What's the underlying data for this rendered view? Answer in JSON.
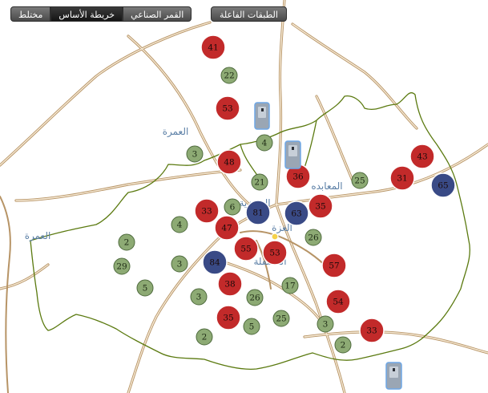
{
  "toolbar": {
    "mixed_label": "مختلط",
    "basemap_label": "خريطة الأساس",
    "satellite_label": "القمر الصناعي",
    "layers_label": "الطبقات الفاعلة",
    "active_tab": "basemap"
  },
  "colors": {
    "red": "#c22a2a",
    "blue": "#394a86",
    "green": "#8daa74",
    "road": "#c8a77a",
    "boundary": "#5b7a10"
  },
  "places": [
    {
      "id": "umra-north",
      "text": "العمرة"
    },
    {
      "id": "umra-west",
      "text": "العمرة"
    },
    {
      "id": "maabda",
      "text": "المعابده"
    },
    {
      "id": "aziziya",
      "text": "العزيزية"
    },
    {
      "id": "ghazza",
      "text": "الغزة"
    },
    {
      "id": "masfala",
      "text": "المسفلة"
    }
  ],
  "markers": [
    {
      "id": "m41",
      "value": "41",
      "color": "red"
    },
    {
      "id": "m22",
      "value": "22",
      "color": "green"
    },
    {
      "id": "m53a",
      "value": "53",
      "color": "red"
    },
    {
      "id": "m4a",
      "value": "4",
      "color": "green"
    },
    {
      "id": "m3a",
      "value": "3",
      "color": "green"
    },
    {
      "id": "m48",
      "value": "48",
      "color": "red"
    },
    {
      "id": "m36",
      "value": "36",
      "color": "red"
    },
    {
      "id": "m21",
      "value": "21",
      "color": "green"
    },
    {
      "id": "m25a",
      "value": "25",
      "color": "green"
    },
    {
      "id": "m43",
      "value": "43",
      "color": "red"
    },
    {
      "id": "m31",
      "value": "31",
      "color": "red"
    },
    {
      "id": "m65",
      "value": "65",
      "color": "blue"
    },
    {
      "id": "m33a",
      "value": "33",
      "color": "red"
    },
    {
      "id": "m6",
      "value": "6",
      "color": "green"
    },
    {
      "id": "m81",
      "value": "81",
      "color": "blue"
    },
    {
      "id": "m63",
      "value": "63",
      "color": "blue"
    },
    {
      "id": "m35a",
      "value": "35",
      "color": "red"
    },
    {
      "id": "m4b",
      "value": "4",
      "color": "green"
    },
    {
      "id": "m47",
      "value": "47",
      "color": "red"
    },
    {
      "id": "m26a",
      "value": "26",
      "color": "green"
    },
    {
      "id": "m2a",
      "value": "2",
      "color": "green"
    },
    {
      "id": "m55",
      "value": "55",
      "color": "red"
    },
    {
      "id": "m53b",
      "value": "53",
      "color": "red"
    },
    {
      "id": "m29",
      "value": "29",
      "color": "green"
    },
    {
      "id": "m3b",
      "value": "3",
      "color": "green"
    },
    {
      "id": "m84",
      "value": "84",
      "color": "blue"
    },
    {
      "id": "m57",
      "value": "57",
      "color": "red"
    },
    {
      "id": "m5a",
      "value": "5",
      "color": "green"
    },
    {
      "id": "m38",
      "value": "38",
      "color": "red"
    },
    {
      "id": "m17",
      "value": "17",
      "color": "green"
    },
    {
      "id": "m3c",
      "value": "3",
      "color": "green"
    },
    {
      "id": "m26b",
      "value": "26",
      "color": "green"
    },
    {
      "id": "m54",
      "value": "54",
      "color": "red"
    },
    {
      "id": "m35b",
      "value": "35",
      "color": "red"
    },
    {
      "id": "m5b",
      "value": "5",
      "color": "green"
    },
    {
      "id": "m25b",
      "value": "25",
      "color": "green"
    },
    {
      "id": "m3d",
      "value": "3",
      "color": "green"
    },
    {
      "id": "m2b",
      "value": "2",
      "color": "green"
    },
    {
      "id": "m33b",
      "value": "33",
      "color": "red"
    },
    {
      "id": "m2c",
      "value": "2",
      "color": "green"
    }
  ],
  "pins": [
    {
      "id": "pin-1",
      "icon": "station-pin-icon"
    },
    {
      "id": "pin-2",
      "icon": "station-pin-icon"
    },
    {
      "id": "pin-3",
      "icon": "station-pin-icon"
    }
  ]
}
